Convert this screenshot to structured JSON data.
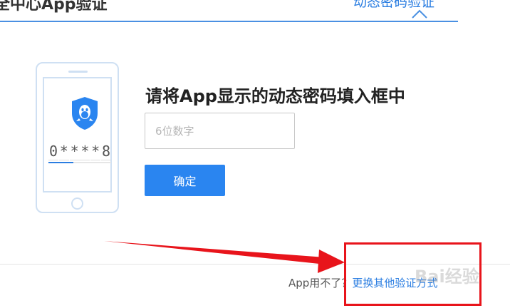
{
  "header": {
    "title": "全中心App验证",
    "right_link": "动态密码验证"
  },
  "phone": {
    "code_chars": [
      "0",
      "*",
      "*",
      "*",
      "*",
      "8"
    ],
    "progress_fraction": 0.4
  },
  "form": {
    "heading": "请将App显示的动态密码填入框中",
    "input_placeholder": "6位数字",
    "input_value": "",
    "confirm_label": "确定"
  },
  "footer": {
    "question": "App用不了？",
    "switch_link": "更换其他验证方式"
  },
  "watermark": "Bai经验",
  "colors": {
    "accent": "#2a85f0",
    "link": "#2a7de1",
    "annotation": "#e8141b",
    "phone_outline": "#cfe0f3"
  }
}
